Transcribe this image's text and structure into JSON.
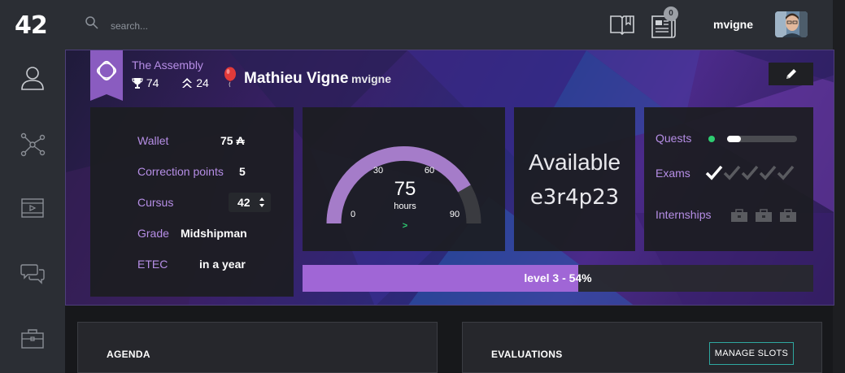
{
  "header": {
    "logo": "42",
    "search_placeholder": "search...",
    "notification_count": "0",
    "username": "mvigne"
  },
  "sidebar": {
    "items": [
      {
        "icon": "user-icon"
      },
      {
        "icon": "network-icon"
      },
      {
        "icon": "video-icon"
      },
      {
        "icon": "chat-icon"
      },
      {
        "icon": "briefcase-icon"
      }
    ]
  },
  "profile": {
    "coalition": "The Assembly",
    "coalition_score": "74",
    "coalition_rank": "24",
    "full_name": "Mathieu Vigne",
    "login": "mvigne"
  },
  "info": {
    "wallet_label": "Wallet",
    "wallet_value": "75 ₳",
    "correction_label": "Correction points",
    "correction_value": "5",
    "cursus_label": "Cursus",
    "cursus_value": "42",
    "grade_label": "Grade",
    "grade_value": "Midshipman",
    "etec_label": "ETEC",
    "etec_value": "in a year"
  },
  "logtime": {
    "value": "75",
    "unit": "hours",
    "ticks": [
      "0",
      "30",
      "60",
      "90"
    ],
    "trend": ">",
    "max": 90
  },
  "availability": {
    "status": "Available",
    "host": "e3r4p23"
  },
  "stats": {
    "quests_label": "Quests",
    "quests_progress": 0.2,
    "exams_label": "Exams",
    "exams_done": 1,
    "exams_total": 5,
    "internships_label": "Internships",
    "internships_total": 3
  },
  "level": {
    "text": "level 3 - 54%",
    "percent": 54
  },
  "cards": {
    "agenda_title": "AGENDA",
    "evaluations_title": "EVALUATIONS",
    "manage_slots_label": "MANAGE SLOTS"
  },
  "colors": {
    "accent": "#b68ee6",
    "level_fill": "#a066d6",
    "online": "#2ecc71",
    "manage_border": "#2ea7a0"
  }
}
